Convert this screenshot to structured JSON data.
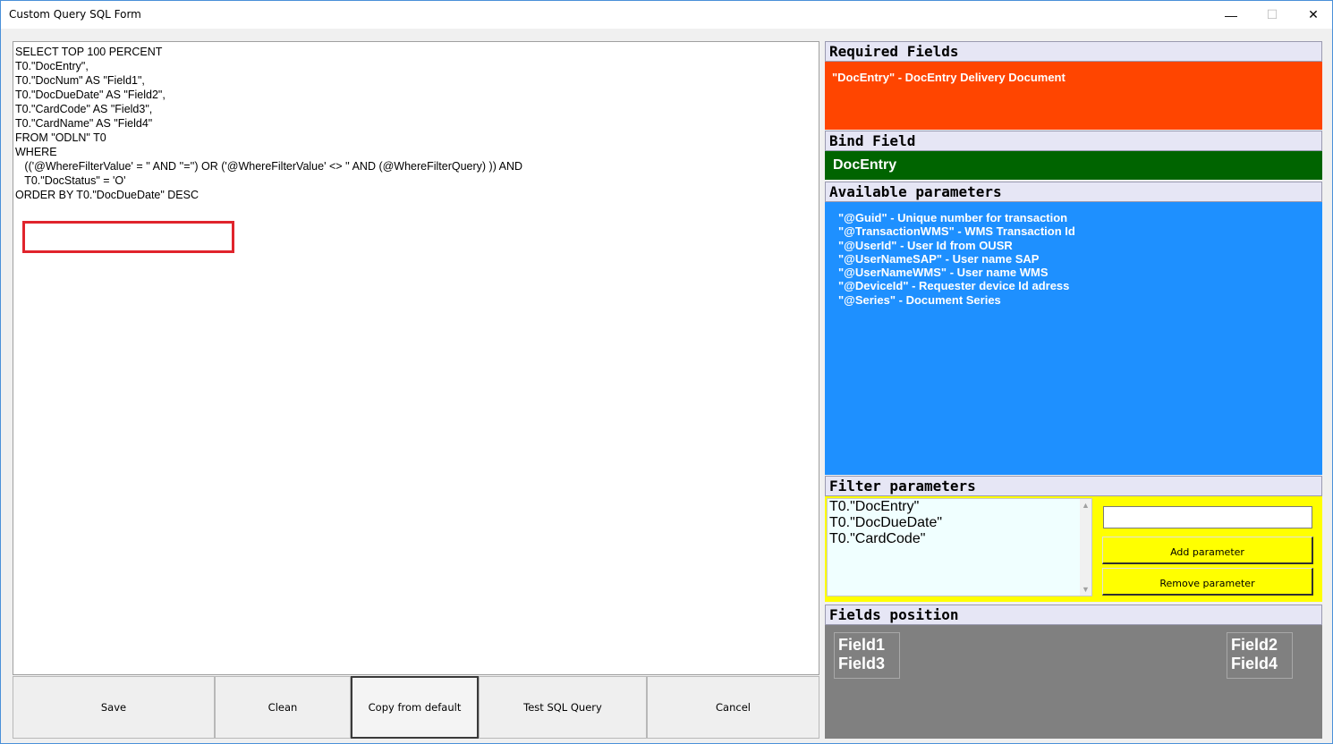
{
  "window": {
    "title": "Custom Query SQL Form",
    "minimize": "—",
    "maximize": "☐",
    "close": "✕"
  },
  "editor": {
    "sql_text": "SELECT TOP 100 PERCENT\nT0.\"DocEntry\",\nT0.\"DocNum\" AS \"Field1\",\nT0.\"DocDueDate\" AS \"Field2\",\nT0.\"CardCode\" AS \"Field3\",\nT0.\"CardName\" AS \"Field4\"\nFROM \"ODLN\" T0\nWHERE\n   (('@WhereFilterValue' = '' AND ''='') OR ('@WhereFilterValue' <> '' AND (@WhereFilterQuery) )) AND\n   T0.\"DocStatus\" = 'O'\nORDER BY T0.\"DocDueDate\" DESC",
    "highlight_color": "#e0242c"
  },
  "buttons": {
    "save": "Save",
    "clean": "Clean",
    "copy_default": "Copy from default",
    "test_sql": "Test SQL Query",
    "cancel": "Cancel"
  },
  "required_fields": {
    "header": "Required Fields",
    "text": "\"DocEntry\" - DocEntry Delivery Document",
    "color": "#ff4500"
  },
  "bind_field": {
    "header": "Bind Field",
    "value": "DocEntry",
    "color": "#006400"
  },
  "available_parameters": {
    "header": "Available parameters",
    "items": [
      "\"@Guid\" - Unique number for transaction",
      "\"@TransactionWMS\" - WMS Transaction Id",
      "\"@UserId\" - User Id from OUSR",
      "\"@UserNameSAP\" - User name SAP",
      "\"@UserNameWMS\" - User name WMS",
      "\"@DeviceId\" - Requester device Id adress",
      "\"@Series\" - Document Series"
    ],
    "color": "#1e90ff"
  },
  "filter_parameters": {
    "header": "Filter parameters",
    "items": [
      "T0.\"DocEntry\"",
      "T0.\"DocDueDate\"",
      "T0.\"CardCode\""
    ],
    "input_value": "",
    "add_label": "Add parameter",
    "remove_label": "Remove parameter",
    "color": "#ffff00"
  },
  "fields_position": {
    "header": "Fields position",
    "left_box": [
      "Field1",
      "Field3"
    ],
    "right_box": [
      "Field2",
      "Field4"
    ],
    "color": "#808080"
  }
}
